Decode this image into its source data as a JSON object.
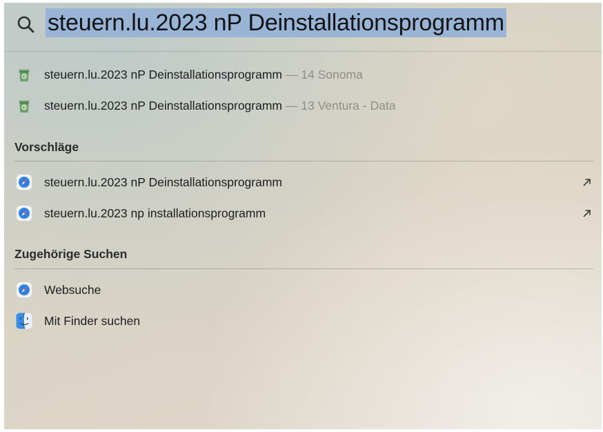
{
  "search": {
    "query": "steuern.lu.2023 nP Deinstallationsprogramm",
    "icon": "magnifying-glass"
  },
  "results": [
    {
      "title": "steuern.lu.2023 nP Deinstallationsprogramm",
      "location": "— 14 Sonoma",
      "icon": "trash-can-app"
    },
    {
      "title": "steuern.lu.2023 nP Deinstallationsprogramm",
      "location": "— 13 Ventura - Data",
      "icon": "trash-can-app"
    }
  ],
  "suggestions": {
    "heading": "Vorschläge",
    "items": [
      {
        "label": "steuern.lu.2023 nP Deinstallationsprogramm",
        "icon": "safari-compass",
        "action_icon": "arrow-up-right"
      },
      {
        "label": "steuern.lu.2023 np installationsprogramm",
        "icon": "safari-compass",
        "action_icon": "arrow-up-right"
      }
    ]
  },
  "related": {
    "heading": "Zugehörige Suchen",
    "items": [
      {
        "label": "Websuche",
        "icon": "safari-compass"
      },
      {
        "label": "Mit Finder suchen",
        "icon": "finder-face"
      }
    ]
  },
  "colors": {
    "selection": "#99b4d4",
    "secondary_text": "#8f8d86",
    "trash_green": "#5c8f5a",
    "safari_blue": "#2f7fe0",
    "finder_blue": "#3a8ee6"
  }
}
